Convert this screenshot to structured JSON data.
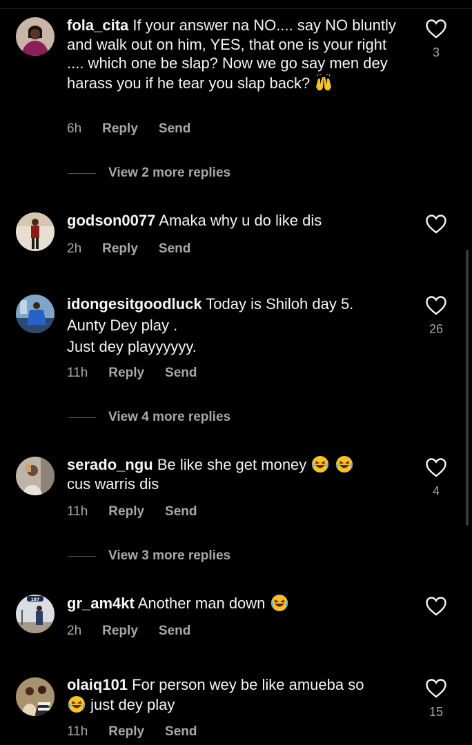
{
  "comments": [
    {
      "username": "fola_cita",
      "text": "If your answer na NO.... say NO bluntly and walk out on him, YES, that one is your right .... which one be slap? Now we go say men dey harass you if he tear you slap back?",
      "emoji": "raising-hands",
      "time": "6h",
      "reply_label": "Reply",
      "send_label": "Send",
      "likes": "3",
      "view_more": "View 2 more replies"
    },
    {
      "username": "godson0077",
      "text": "Amaka why u do like dis",
      "time": "2h",
      "reply_label": "Reply",
      "send_label": "Send",
      "likes": ""
    },
    {
      "username": "idongesitgoodluck",
      "text": "Today is Shiloh day 5.\nAunty Dey play .\nJust dey playyyyyy.",
      "time": "11h",
      "reply_label": "Reply",
      "send_label": "Send",
      "likes": "26",
      "view_more": "View 4 more replies"
    },
    {
      "username": "serado_ngu",
      "text_before": "Be like she get money",
      "text_after": "cus warris dis",
      "time": "11h",
      "reply_label": "Reply",
      "send_label": "Send",
      "likes": "4",
      "view_more": "View 3 more replies"
    },
    {
      "username": "gr_am4kt",
      "text": "Another man down",
      "time": "2h",
      "reply_label": "Reply",
      "send_label": "Send",
      "likes": ""
    },
    {
      "username": "olaiq101",
      "text": "For person wey be like amueba so",
      "text_after": "just dey play",
      "time": "11h",
      "reply_label": "Reply",
      "send_label": "Send",
      "likes": "15"
    }
  ],
  "avatar_badge": "187",
  "colors": {
    "background": "#000000",
    "text": "#f5f5f5",
    "secondary": "#a8a8a8"
  }
}
